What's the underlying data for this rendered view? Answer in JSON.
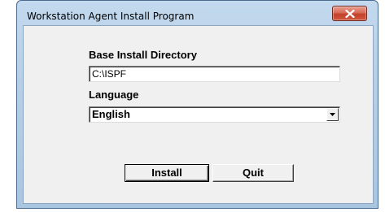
{
  "window": {
    "title": "Workstation Agent Install Program",
    "close_icon": "close-icon"
  },
  "form": {
    "dir_label": "Base Install Directory",
    "dir_value": "C:\\ISPF",
    "lang_label": "Language",
    "lang_value": "English",
    "lang_arrow_icon": "chevron-down-icon"
  },
  "buttons": {
    "install_label": "Install",
    "quit_label": "Quit"
  },
  "colors": {
    "close_button": "#c7432c",
    "window_frame": "#b6cfe6",
    "client_bg": "#f0f0f0"
  }
}
